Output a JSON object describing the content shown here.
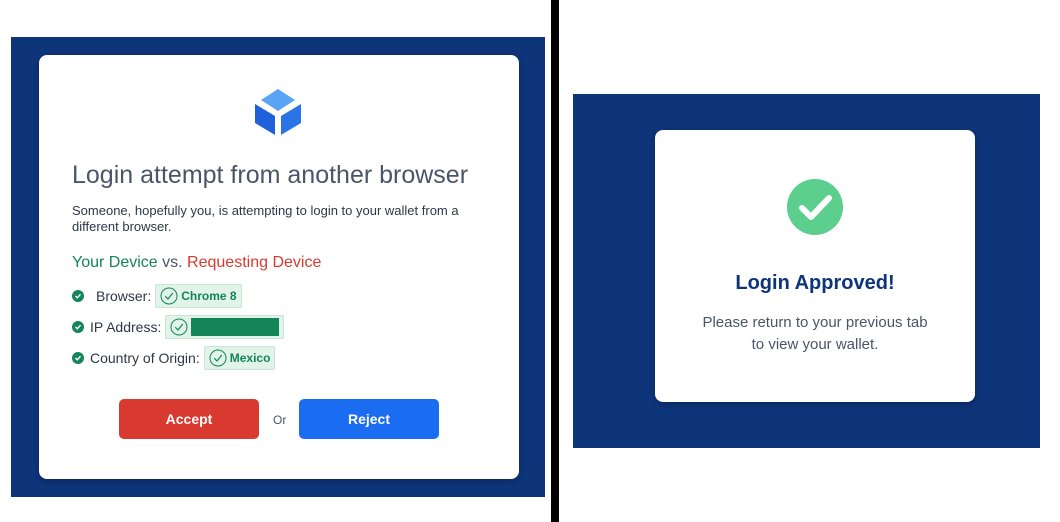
{
  "left_dialog": {
    "logo_icon": "blockchain-cube-logo-icon",
    "title": "Login attempt from another browser",
    "subtitle": "Someone, hopefully you, is attempting to login to your wallet from a different browser.",
    "comparison": {
      "your_device": "Your Device",
      "vs": "vs.",
      "requesting_device": "Requesting Device"
    },
    "details": [
      {
        "label": "Browser:",
        "value": "Chrome 8",
        "status_icon": "check-circle-icon"
      },
      {
        "label": "IP Address:",
        "value": "",
        "redacted": true,
        "status_icon": "check-circle-icon"
      },
      {
        "label": "Country of Origin:",
        "value": "Mexico",
        "status_icon": "check-circle-icon"
      }
    ],
    "accept_label": "Accept",
    "or_label": "Or",
    "reject_label": "Reject"
  },
  "right_dialog": {
    "success_icon": "checkmark-circle-icon",
    "title": "Login Approved!",
    "message": "Please return to your previous tab to view your wallet."
  },
  "colors": {
    "background_navy": "#0e3479",
    "green": "#138558",
    "red": "#d93a2f",
    "blue": "#1a6cf0",
    "success_green": "#5ccf8f"
  }
}
